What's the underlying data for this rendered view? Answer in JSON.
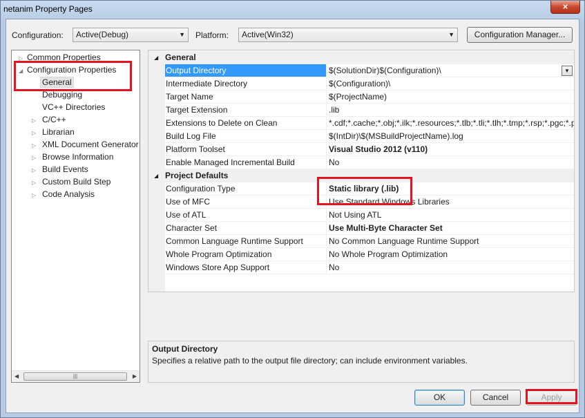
{
  "window": {
    "title": "netanim Property Pages",
    "close_glyph": "×"
  },
  "toolbar": {
    "configuration_label": "Configuration:",
    "configuration_value": "Active(Debug)",
    "platform_label": "Platform:",
    "platform_value": "Active(Win32)",
    "manager_button": "Configuration Manager..."
  },
  "tree": {
    "items": [
      {
        "label": "Common Properties",
        "expander": "▷"
      },
      {
        "label": "Configuration Properties",
        "expander": "◢"
      },
      {
        "label": "General",
        "expander": ""
      },
      {
        "label": "Debugging",
        "expander": ""
      },
      {
        "label": "VC++ Directories",
        "expander": ""
      },
      {
        "label": "C/C++",
        "expander": "▷"
      },
      {
        "label": "Librarian",
        "expander": "▷"
      },
      {
        "label": "XML Document Generator",
        "expander": "▷"
      },
      {
        "label": "Browse Information",
        "expander": "▷"
      },
      {
        "label": "Build Events",
        "expander": "▷"
      },
      {
        "label": "Custom Build Step",
        "expander": "▷"
      },
      {
        "label": "Code Analysis",
        "expander": "▷"
      }
    ],
    "scroll_left": "◀",
    "scroll_right": "▶",
    "thumb_grip": "|||"
  },
  "grid": {
    "categories": [
      {
        "name": "General",
        "rows": [
          {
            "name": "Output Directory",
            "value": "$(SolutionDir)$(Configuration)\\"
          },
          {
            "name": "Intermediate Directory",
            "value": "$(Configuration)\\"
          },
          {
            "name": "Target Name",
            "value": "$(ProjectName)"
          },
          {
            "name": "Target Extension",
            "value": ".lib"
          },
          {
            "name": "Extensions to Delete on Clean",
            "value": "*.cdf;*.cache;*.obj;*.ilk;*.resources;*.tlb;*.tli;*.tlh;*.tmp;*.rsp;*.pgc;*.p"
          },
          {
            "name": "Build Log File",
            "value": "$(IntDir)\\$(MSBuildProjectName).log"
          },
          {
            "name": "Platform Toolset",
            "value": "Visual Studio 2012 (v110)"
          },
          {
            "name": "Enable Managed Incremental Build",
            "value": "No"
          }
        ]
      },
      {
        "name": "Project Defaults",
        "rows": [
          {
            "name": "Configuration Type",
            "value": "Static library (.lib)"
          },
          {
            "name": "Use of MFC",
            "value": "Use Standard Windows Libraries"
          },
          {
            "name": "Use of ATL",
            "value": "Not Using ATL"
          },
          {
            "name": "Character Set",
            "value": "Use Multi-Byte Character Set"
          },
          {
            "name": "Common Language Runtime Support",
            "value": "No Common Language Runtime Support"
          },
          {
            "name": "Whole Program Optimization",
            "value": "No Whole Program Optimization"
          },
          {
            "name": "Windows Store App Support",
            "value": "No"
          }
        ]
      }
    ],
    "expander": "◢",
    "dropdown_glyph": "▼"
  },
  "description": {
    "title": "Output Directory",
    "text": "Specifies a relative path to the output file directory; can include environment variables."
  },
  "buttons": {
    "ok": "OK",
    "cancel": "Cancel",
    "apply": "Apply"
  },
  "colors": {
    "annotation": "#e3141f",
    "selection": "#3399ff"
  }
}
